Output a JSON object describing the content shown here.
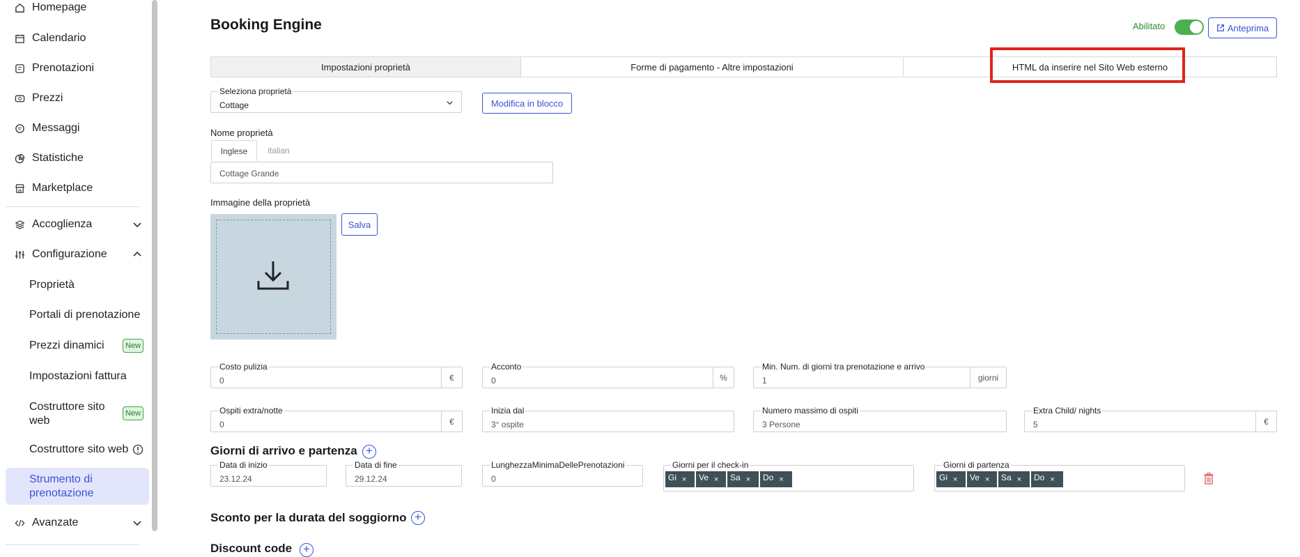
{
  "sidebar": {
    "items": [
      {
        "label": "Homepage",
        "icon": "home-icon"
      },
      {
        "label": "Calendario",
        "icon": "calendar-icon"
      },
      {
        "label": "Prenotazioni",
        "icon": "booking-icon"
      },
      {
        "label": "Prezzi",
        "icon": "money-icon"
      },
      {
        "label": "Messaggi",
        "icon": "message-icon"
      },
      {
        "label": "Statistiche",
        "icon": "chart-icon"
      },
      {
        "label": "Marketplace",
        "icon": "store-icon"
      },
      {
        "label": "Accoglienza",
        "icon": "layers-icon"
      },
      {
        "label": "Configurazione",
        "icon": "sliders-icon"
      }
    ],
    "sub_items": {
      "proprieta": "Proprietà",
      "portali": "Portali di prenotazione",
      "prezzi_dinamici": "Prezzi dinamici",
      "impostazioni_fattura": "Impostazioni fattura",
      "costruttore_new": "Costruttore sito web",
      "costruttore": "Costruttore sito web",
      "strumento": "Strumento di prenotazione"
    },
    "new_badge": "New",
    "avanzate": "Avanzate"
  },
  "header": {
    "title": "Booking Engine",
    "enabled_label": "Abilitato",
    "preview_label": "Anteprima"
  },
  "tabs": [
    {
      "label": "Impostazioni proprietà"
    },
    {
      "label": "Forme di pagamento - Altre impostazioni"
    },
    {
      "label": "HTML da inserire nel Sito Web esterno"
    }
  ],
  "form": {
    "select_property": {
      "label": "Seleziona proprietà",
      "value": "Cottage"
    },
    "bulk_edit_button": "Modifica in blocco",
    "property_name_label": "Nome proprietà",
    "lang_tabs": [
      "Inglese",
      "italian"
    ],
    "property_name_value": "Cottage Grande",
    "property_image_label": "Immagine della proprietà",
    "save_button": "Salva",
    "costo_pulizia": {
      "label": "Costo pulizia",
      "value": "0",
      "suffix": "€"
    },
    "acconto": {
      "label": "Acconto",
      "value": "0",
      "suffix": "%"
    },
    "min_giorni": {
      "label": "Min. Num. di giorni tra prenotazione e arrivo",
      "value": "1",
      "suffix": "giorni"
    },
    "ospiti_extra": {
      "label": "Ospiti extra/notte",
      "value": "0",
      "suffix": "€"
    },
    "inizia_dal": {
      "label": "Inizia dal",
      "value": "3° ospite"
    },
    "max_ospiti": {
      "label": "Numero massimo di ospiti",
      "value": "3 Persone"
    },
    "extra_child": {
      "label": "Extra Child/ nights",
      "value": "5",
      "suffix": "€"
    }
  },
  "arrivals": {
    "title": "Giorni di arrivo e partenza",
    "data_inizio": {
      "label": "Data di inizio",
      "value": "23.12.24"
    },
    "data_fine": {
      "label": "Data di fine",
      "value": "29.12.24"
    },
    "lunghezza": {
      "label": "LunghezzaMinimaDellePrenotazioni",
      "value": "0"
    },
    "checkin": {
      "label": "Giorni per il check-in",
      "chips": [
        "Gi",
        "Ve",
        "Sa",
        "Do"
      ]
    },
    "partenza": {
      "label": "Giorni di partenza",
      "chips": [
        "Gi",
        "Ve",
        "Sa",
        "Do"
      ]
    },
    "chip_remove": "×"
  },
  "sections": {
    "sconto": "Sconto per la durata del soggiorno",
    "discount": "Discount code"
  },
  "colors": {
    "accent": "#3a52d6",
    "active_bg": "#e3e6fb",
    "toggle_on": "#4caf50",
    "highlight": "#e0241b"
  }
}
